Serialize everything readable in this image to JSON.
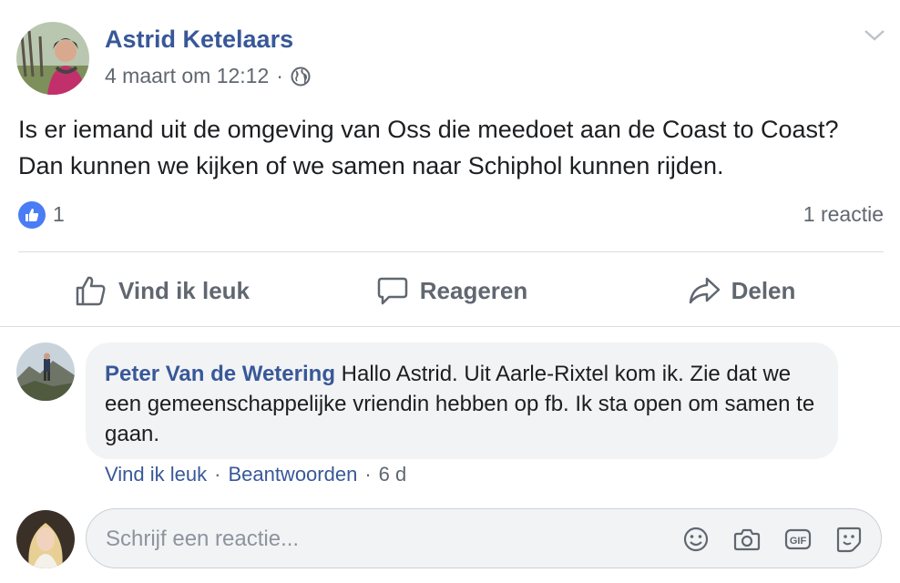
{
  "post": {
    "author": "Astrid Ketelaars",
    "timestamp": "4 maart om 12:12",
    "separator": "·",
    "privacy_icon": "globe-icon",
    "text": "Is er iemand uit de omgeving van Oss die meedoet aan de Coast to Coast? Dan kunnen we kijken of we samen naar Schiphol kunnen rijden.",
    "like_count": "1",
    "comment_count": "1 reactie"
  },
  "actions": {
    "like": "Vind ik leuk",
    "comment": "Reageren",
    "share": "Delen"
  },
  "comment": {
    "author": "Peter Van de Wetering",
    "text": " Hallo Astrid. Uit Aarle-Rixtel kom ik. Zie dat we een gemeenschappelijke vriendin hebben op fb. Ik sta open om samen te gaan.",
    "like_label": "Vind ik leuk",
    "reply_label": "Beantwoorden",
    "age": "6 d",
    "sep": "·"
  },
  "reply_box": {
    "placeholder": "Schrijf een reactie...",
    "tools": [
      "emoji-icon",
      "camera-icon",
      "gif-icon",
      "sticker-icon"
    ]
  },
  "colors": {
    "link_blue": "#385898",
    "like_blue": "#4a7cf5",
    "muted": "#606770"
  }
}
